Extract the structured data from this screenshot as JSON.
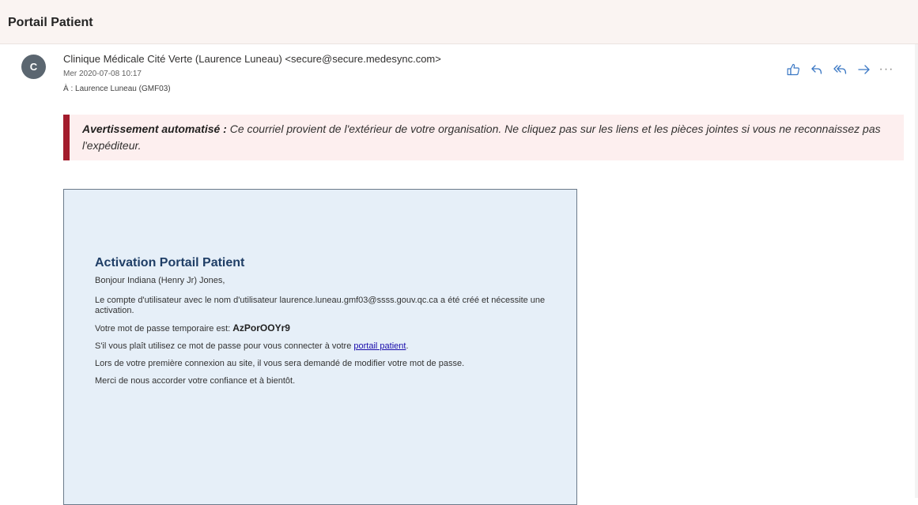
{
  "header": {
    "subject": "Portail Patient"
  },
  "message": {
    "avatar_initial": "C",
    "from": "Clinique Médicale Cité Verte (Laurence Luneau) <secure@secure.medesync.com>",
    "date": "Mer 2020-07-08 10:17",
    "to": "À : Laurence Luneau (GMF03)"
  },
  "actions": {
    "icons": [
      "thumbs-up-icon",
      "reply-icon",
      "reply-all-icon",
      "forward-icon",
      "more-icon"
    ],
    "more_label": "···"
  },
  "warning": {
    "label": "Avertissement automatisé :",
    "text": " Ce courriel provient de l'extérieur de votre organisation. Ne cliquez pas sur les liens et les pièces jointes si vous ne reconnaissez pas l'expéditeur."
  },
  "body": {
    "title": "Activation Portail Patient",
    "greeting": "Bonjour Indiana (Henry Jr) Jones,",
    "account_line": "Le compte d'utilisateur avec le nom d'utilisateur laurence.luneau.gmf03@ssss.gouv.qc.ca a été créé et nécessite une activation.",
    "password_prefix": "Votre mot de passe temporaire est: ",
    "password": "AzPorOOYr9",
    "login_prefix": "S'il vous plaît utilisez ce mot de passe pour vous connecter à votre ",
    "login_link": "portail patient",
    "login_suffix": ".",
    "first_login": "Lors de votre première connexion au site, il vous sera demandé de modifier votre mot de passe.",
    "thanks": "Merci de nous accorder votre confiance et à bientôt."
  },
  "colors": {
    "warning_border": "#a31c2c",
    "warning_bg": "#fdefef",
    "email_bg": "#e6eff8",
    "title_color": "#1f3e66",
    "link_color": "#1a0dab",
    "action_icon": "#3b78c4"
  }
}
